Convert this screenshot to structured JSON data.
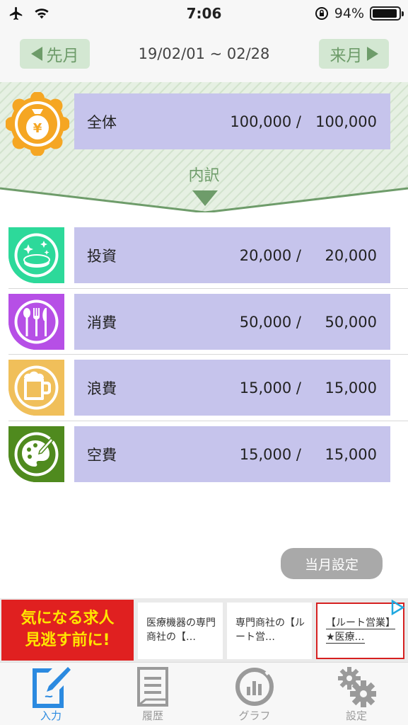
{
  "status_bar": {
    "time": "7:06",
    "battery": "94%",
    "battery_level": 0.94
  },
  "header": {
    "prev_label": "先月",
    "next_label": "来月",
    "period": "19/02/01 ~ 02/28"
  },
  "summary": {
    "name": "全体",
    "used": "100,000 /",
    "budget": "100,000",
    "breakdown_label": "内訳"
  },
  "categories": [
    {
      "name": "投資",
      "used": "20,000 /",
      "budget": "20,000",
      "icon": "coins-icon",
      "color": "#2dd99a"
    },
    {
      "name": "消費",
      "used": "50,000 /",
      "budget": "50,000",
      "icon": "cutlery-icon",
      "color": "#b64fe6"
    },
    {
      "name": "浪費",
      "used": "15,000 /",
      "budget": "15,000",
      "icon": "beer-icon",
      "color": "#f0bf5a"
    },
    {
      "name": "空費",
      "used": "15,000 /",
      "budget": "15,000",
      "icon": "palette-icon",
      "color": "#4f8a1e"
    }
  ],
  "month_setting_label": "当月設定",
  "ad": {
    "banner_line1": "気になる求人",
    "banner_line2": "見逃す前に!",
    "item1": "医療機器の専門商社の【…",
    "item2": "専門商社の【ルート営…",
    "item3": "【ルート営業】★医療…"
  },
  "tabs": [
    {
      "label": "入力",
      "icon": "input-pen-icon",
      "active": true
    },
    {
      "label": "履歴",
      "icon": "history-document-icon",
      "active": false
    },
    {
      "label": "グラフ",
      "icon": "graph-chart-icon",
      "active": false
    },
    {
      "label": "設定",
      "icon": "settings-gear-icon",
      "active": false
    }
  ],
  "colors": {
    "accent_green": "#6e9c6a",
    "bar_lavender": "#c6c4ec",
    "tab_active": "#2b8ae0",
    "summary_icon": "#f5a623"
  }
}
